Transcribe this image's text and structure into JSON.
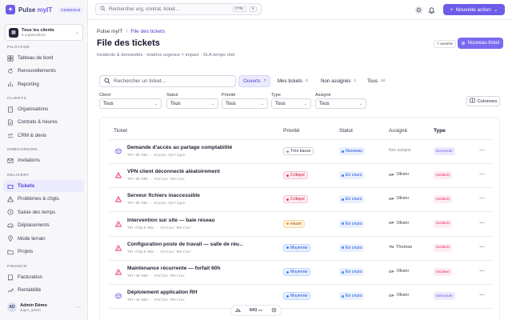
{
  "brand": {
    "name": "Pulse",
    "product": "myIT",
    "badge": "CONSOLE"
  },
  "client_switcher": {
    "title": "Tous les clients",
    "subtitle": "9 organisations"
  },
  "sidebar": {
    "sections": [
      {
        "label": "PILOTAGE",
        "items": [
          {
            "label": "Tableau de bord",
            "icon": "grid-icon"
          },
          {
            "label": "Renouvellements",
            "icon": "refresh-icon"
          },
          {
            "label": "Reporting",
            "icon": "chart-icon"
          }
        ]
      },
      {
        "label": "CLIENTS",
        "items": [
          {
            "label": "Organisations",
            "icon": "building-icon"
          },
          {
            "label": "Contrats & heures",
            "icon": "contract-icon"
          },
          {
            "label": "CRM & devis",
            "icon": "crm-icon"
          }
        ]
      },
      {
        "label": "ONBOARDING",
        "items": [
          {
            "label": "Invitations",
            "icon": "mail-icon"
          }
        ]
      },
      {
        "label": "DELIVERY",
        "items": [
          {
            "label": "Tickets",
            "icon": "ticket-icon",
            "active": true
          },
          {
            "label": "Problèmes & chgts",
            "icon": "alert-icon"
          },
          {
            "label": "Saisie des temps",
            "icon": "clock-icon"
          },
          {
            "label": "Déplacements",
            "icon": "car-icon"
          },
          {
            "label": "Mode terrain",
            "icon": "pin-icon"
          },
          {
            "label": "Projets",
            "icon": "folder-icon"
          }
        ]
      },
      {
        "label": "FINANCE",
        "items": [
          {
            "label": "Facturation",
            "icon": "invoice-icon"
          },
          {
            "label": "Rentabilité",
            "icon": "trend-icon"
          }
        ]
      }
    ]
  },
  "user": {
    "initials": "AD",
    "name": "Admin Démo",
    "role": "super_admin"
  },
  "topbar": {
    "search_placeholder": "Rechercher org, contrat, ticket…",
    "shortcut_keys": [
      "CTRL",
      "K"
    ],
    "new_action_label": "Nouvelle action"
  },
  "breadcrumb": {
    "root": "Pulse myIT",
    "separator": "/",
    "current": "File des tickets"
  },
  "page": {
    "title": "File des tickets",
    "subtitle": "Incidents & demandes · matrice urgence × impact · SLA temps réel",
    "open_count_label": "7 ouverts",
    "new_ticket_label": "Nouveau ticket"
  },
  "filters": {
    "search_placeholder": "Rechercher un ticket…",
    "segments": [
      {
        "label": "Ouverts",
        "count": "7",
        "active": true
      },
      {
        "label": "Mes tickets",
        "count": "0"
      },
      {
        "label": "Non assignés",
        "count": "1"
      },
      {
        "label": "Tous",
        "count": "10"
      }
    ],
    "selects": [
      {
        "label": "Client",
        "value": "Tous"
      },
      {
        "label": "Statut",
        "value": "Tous"
      },
      {
        "label": "Priorité",
        "value": "Tous"
      },
      {
        "label": "Type",
        "value": "Tous"
      },
      {
        "label": "Assigné",
        "value": "Tous"
      }
    ],
    "columns_label": "Colonnes"
  },
  "table": {
    "headers": {
      "ticket": "Ticket",
      "priority": "Priorité",
      "status": "Statut",
      "assignee": "Assigné",
      "type": "Type"
    },
    "rows": [
      {
        "title": "Demande d'accès au partage comptabilité",
        "meta": "TKT-68-002 · Studio Garrigue",
        "icon": "request-icon",
        "priority": "Très basse",
        "priority_color": "#9aa0b0",
        "status": "Nouveau",
        "status_color": "#3b82f6",
        "assignee": "Non assigné",
        "assignee_initials": "",
        "type": "Demande"
      },
      {
        "title": "VPN client déconnecté aléatoirement",
        "meta": "TKT-50-005 · Atelier Mercier",
        "icon": "warning-icon",
        "priority": "Critique",
        "priority_color": "#ef4444",
        "status": "En cours",
        "status_color": "#3b82f6",
        "assignee": "Olivier",
        "assignee_initials": "OP",
        "type": "Incident"
      },
      {
        "title": "Serveur fichiers inaccessible",
        "meta": "TKT-68-001 · Studio Garrigue",
        "icon": "warning-icon",
        "priority": "Critique",
        "priority_color": "#ef4444",
        "status": "En cours",
        "status_color": "#3b82f6",
        "assignee": "Olivier",
        "assignee_initials": "OP",
        "type": "Incident"
      },
      {
        "title": "Intervention sur site — baie réseau",
        "meta": "TKT-FIELD-001 · Atelier Mercier",
        "icon": "warning-icon",
        "priority": "Haute",
        "priority_color": "#f59e0b",
        "status": "En cours",
        "status_color": "#3b82f6",
        "assignee": "Olivier",
        "assignee_initials": "OP",
        "type": "Incident"
      },
      {
        "title": "Configuration poste de travail — salle de réu…",
        "meta": "TKT-FIELD-002 · Atelier Mercier",
        "icon": "warning-icon",
        "priority": "Moyenne",
        "priority_color": "#3b82f6",
        "status": "En cours",
        "status_color": "#3b82f6",
        "assignee": "Thomas",
        "assignee_initials": "TN",
        "type": "Incident"
      },
      {
        "title": "Maintenance récurrente — forfait 60h",
        "meta": "TKT-50-006 · Atelier Mercier",
        "icon": "warning-icon",
        "priority": "Moyenne",
        "priority_color": "#3b82f6",
        "status": "En cours",
        "status_color": "#3b82f6",
        "assignee": "Olivier",
        "assignee_initials": "OP",
        "type": "Incident"
      },
      {
        "title": "Déploiement application RH",
        "meta": "TKT-44-003 · Atelier Mercier",
        "icon": "request-icon",
        "priority": "Moyenne",
        "priority_color": "#3b82f6",
        "status": "En cours",
        "status_color": "#3b82f6",
        "assignee": "Olivier",
        "assignee_initials": "OP",
        "type": "Demande"
      }
    ]
  },
  "float_bar": {
    "value": "643",
    "unit": "ms"
  },
  "colors": {
    "accent": "#6c5ce7",
    "incident": "#e0245e",
    "demande": "#6c5ce7"
  }
}
